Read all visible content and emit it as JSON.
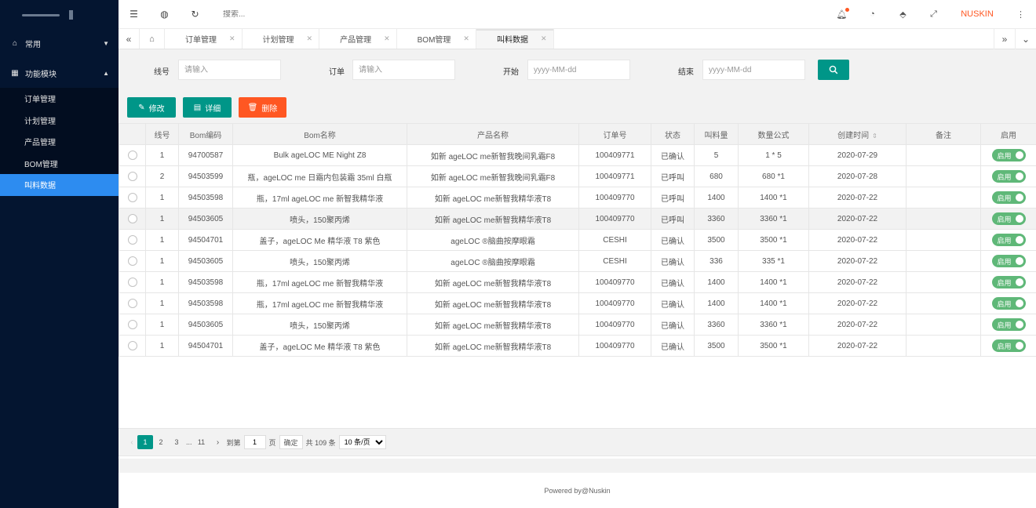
{
  "sidebar": {
    "groups": [
      {
        "icon": "home-icon",
        "label": "常用"
      },
      {
        "icon": "grid-icon",
        "label": "功能模块"
      }
    ],
    "items": [
      "订单管理",
      "计划管理",
      "产品管理",
      "BOM管理",
      "叫料数据"
    ],
    "active_item": "叫料数据"
  },
  "header": {
    "search_placeholder": "搜索...",
    "brand": "NUSKIN"
  },
  "tabs": {
    "items": [
      "订单管理",
      "计划管理",
      "产品管理",
      "BOM管理",
      "叫料数据"
    ],
    "active": "叫料数据"
  },
  "filter": {
    "line_label": "线号",
    "line_placeholder": "请输入",
    "order_label": "订单",
    "order_placeholder": "请输入",
    "start_label": "开始",
    "start_placeholder": "yyyy-MM-dd",
    "end_label": "结束",
    "end_placeholder": "yyyy-MM-dd"
  },
  "toolbar": {
    "edit_label": "修改",
    "detail_label": "详细",
    "delete_label": "删除"
  },
  "table": {
    "headers": [
      "",
      "线号",
      "Bom编码",
      "Bom名称",
      "产品名称",
      "订单号",
      "状态",
      "叫料量",
      "数量公式",
      "创建时间",
      "备注",
      "启用"
    ],
    "switch_label": "启用",
    "rows": [
      {
        "line": "1",
        "bom_code": "94700587",
        "bom_name": "Bulk ageLOC ME Night Z8",
        "product": "如新 ageLOC me新智我晚间乳霜F8",
        "order": "100409771",
        "status": "已确认",
        "qty": "5",
        "formula": "1 * 5",
        "created": "2020-07-29",
        "remark": ""
      },
      {
        "line": "2",
        "bom_code": "94503599",
        "bom_name": "瓶，ageLOC me 日霜内包装霜 35ml 白瓶",
        "product": "如新 ageLOC me新智我晚间乳霜F8",
        "order": "100409771",
        "status": "已呼叫",
        "qty": "680",
        "formula": "680 *1",
        "created": "2020-07-28",
        "remark": ""
      },
      {
        "line": "1",
        "bom_code": "94503598",
        "bom_name": "瓶，17ml ageLOC me 新智我精华液",
        "product": "如新 ageLOC me新智我精华液T8",
        "order": "100409770",
        "status": "已呼叫",
        "qty": "1400",
        "formula": "1400 *1",
        "created": "2020-07-22",
        "remark": ""
      },
      {
        "line": "1",
        "bom_code": "94503605",
        "bom_name": "喷头，150聚丙烯",
        "product": "如新 ageLOC me新智我精华液T8",
        "order": "100409770",
        "status": "已呼叫",
        "qty": "3360",
        "formula": "3360 *1",
        "created": "2020-07-22",
        "remark": ""
      },
      {
        "line": "1",
        "bom_code": "94504701",
        "bom_name": "盖子，ageLOC Me 精华液 T8 紫色",
        "product": "ageLOC ®脑曲按摩眼霜",
        "order": "CESHI",
        "status": "已确认",
        "qty": "3500",
        "formula": "3500 *1",
        "created": "2020-07-22",
        "remark": ""
      },
      {
        "line": "1",
        "bom_code": "94503605",
        "bom_name": "喷头，150聚丙烯",
        "product": "ageLOC ®脑曲按摩眼霜",
        "order": "CESHI",
        "status": "已确认",
        "qty": "336",
        "formula": "335 *1",
        "created": "2020-07-22",
        "remark": ""
      },
      {
        "line": "1",
        "bom_code": "94503598",
        "bom_name": "瓶，17ml ageLOC me 新智我精华液",
        "product": "如新 ageLOC me新智我精华液T8",
        "order": "100409770",
        "status": "已确认",
        "qty": "1400",
        "formula": "1400 *1",
        "created": "2020-07-22",
        "remark": ""
      },
      {
        "line": "1",
        "bom_code": "94503598",
        "bom_name": "瓶，17ml ageLOC me 新智我精华液",
        "product": "如新 ageLOC me新智我精华液T8",
        "order": "100409770",
        "status": "已确认",
        "qty": "1400",
        "formula": "1400 *1",
        "created": "2020-07-22",
        "remark": ""
      },
      {
        "line": "1",
        "bom_code": "94503605",
        "bom_name": "喷头，150聚丙烯",
        "product": "如新 ageLOC me新智我精华液T8",
        "order": "100409770",
        "status": "已确认",
        "qty": "3360",
        "formula": "3360 *1",
        "created": "2020-07-22",
        "remark": ""
      },
      {
        "line": "1",
        "bom_code": "94504701",
        "bom_name": "盖子，ageLOC Me 精华液 T8 紫色",
        "product": "如新 ageLOC me新智我精华液T8",
        "order": "100409770",
        "status": "已确认",
        "qty": "3500",
        "formula": "3500 *1",
        "created": "2020-07-22",
        "remark": ""
      }
    ]
  },
  "pagination": {
    "pages": [
      "1",
      "2",
      "3"
    ],
    "ellipsis": "...",
    "last_page": "11",
    "current": "1",
    "goto_label": "到第",
    "goto_value": "1",
    "page_unit": "页",
    "confirm_label": "确定",
    "total_text": "共 109 条",
    "page_size": "10 条/页"
  },
  "footer": {
    "text": "Powered by@Nuskin"
  },
  "colors": {
    "sidebar_bg": "#041530",
    "active_menu": "#2d8cf0",
    "primary": "#009688",
    "danger": "#ff5722",
    "switch_on": "#5fb878",
    "brand": "#ff5722"
  }
}
